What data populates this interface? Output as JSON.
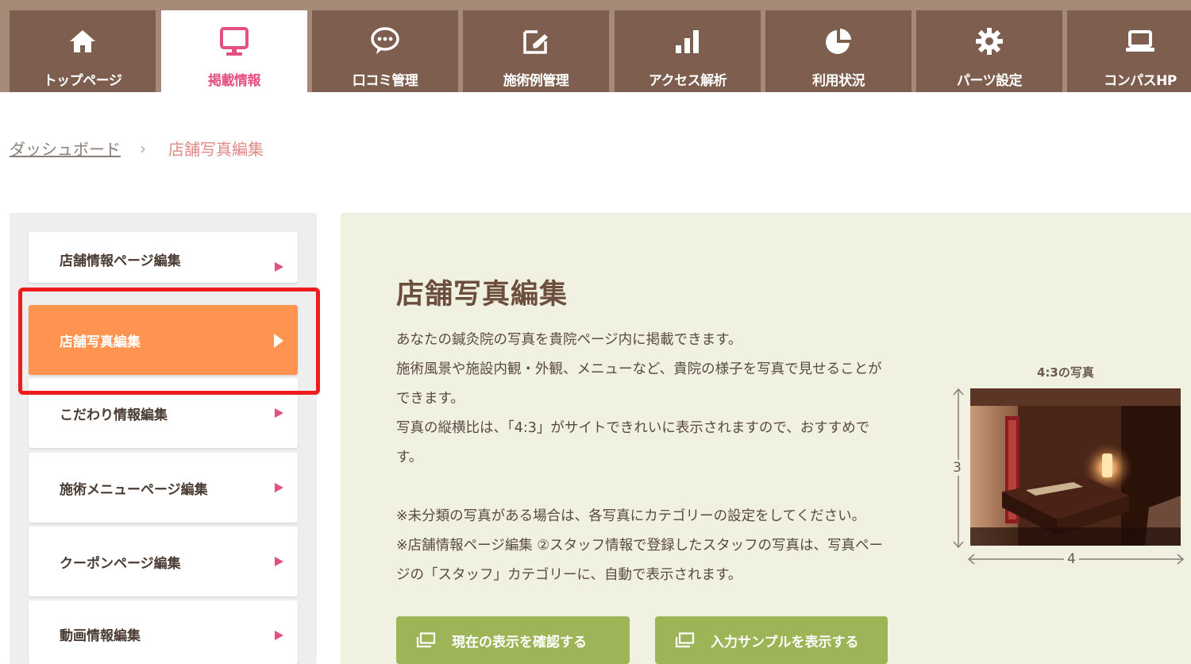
{
  "nav": {
    "tabs": [
      {
        "label": "トップページ",
        "icon": "home-icon"
      },
      {
        "label": "掲載情報",
        "icon": "monitor-icon",
        "active": true
      },
      {
        "label": "口コミ管理",
        "icon": "chat-icon"
      },
      {
        "label": "施術例管理",
        "icon": "edit-icon"
      },
      {
        "label": "アクセス解析",
        "icon": "bar-chart-icon"
      },
      {
        "label": "利用状況",
        "icon": "pie-chart-icon"
      },
      {
        "label": "パーツ設定",
        "icon": "gear-icon"
      },
      {
        "label": "コンパスHP",
        "icon": "laptop-icon"
      }
    ]
  },
  "breadcrumb": {
    "home": "ダッシュボード",
    "current": "店舗写真編集"
  },
  "sidebar": {
    "items": [
      {
        "label": "店舗情報ページ編集"
      },
      {
        "label": "店舗写真編集",
        "active": true
      },
      {
        "label": "こだわり情報編集"
      },
      {
        "label": "施術メニューページ編集"
      },
      {
        "label": "クーポンページ編集"
      },
      {
        "label": "動画情報編集"
      }
    ]
  },
  "main": {
    "title": "店舗写真編集",
    "desc_lines": [
      "あなたの鍼灸院の写真を貴院ページ内に掲載できます。",
      "施術風景や施設内観・外観、メニューなど、貴院の様子を写真で見せることが",
      "できます。",
      "写真の縦横比は、「4:3」がサイトできれいに表示されますので、おすすめで",
      "す。",
      "",
      "※未分類の写真がある場合は、各写真にカテゴリーの設定をしてください。",
      "※店舗情報ページ編集 ②スタッフ情報で登録したスタッフの写真は、写真ペー",
      "ジの「スタッフ」カテゴリーに、自動で表示されます。"
    ],
    "photo_caption": "4:3の写真",
    "dim_height": "3",
    "dim_width": "4",
    "buttons": {
      "check": "現在の表示を確認する",
      "sample": "入力サンプルを表示する"
    }
  },
  "colors": {
    "nav_bg": "#a68a78",
    "tab_bg": "#7e5f4f",
    "accent_pink": "#e5517f",
    "active_orange": "#ff9450",
    "highlight_red": "#ee1c1c",
    "button_green": "#9db557",
    "main_bg": "#f1f1e2"
  }
}
